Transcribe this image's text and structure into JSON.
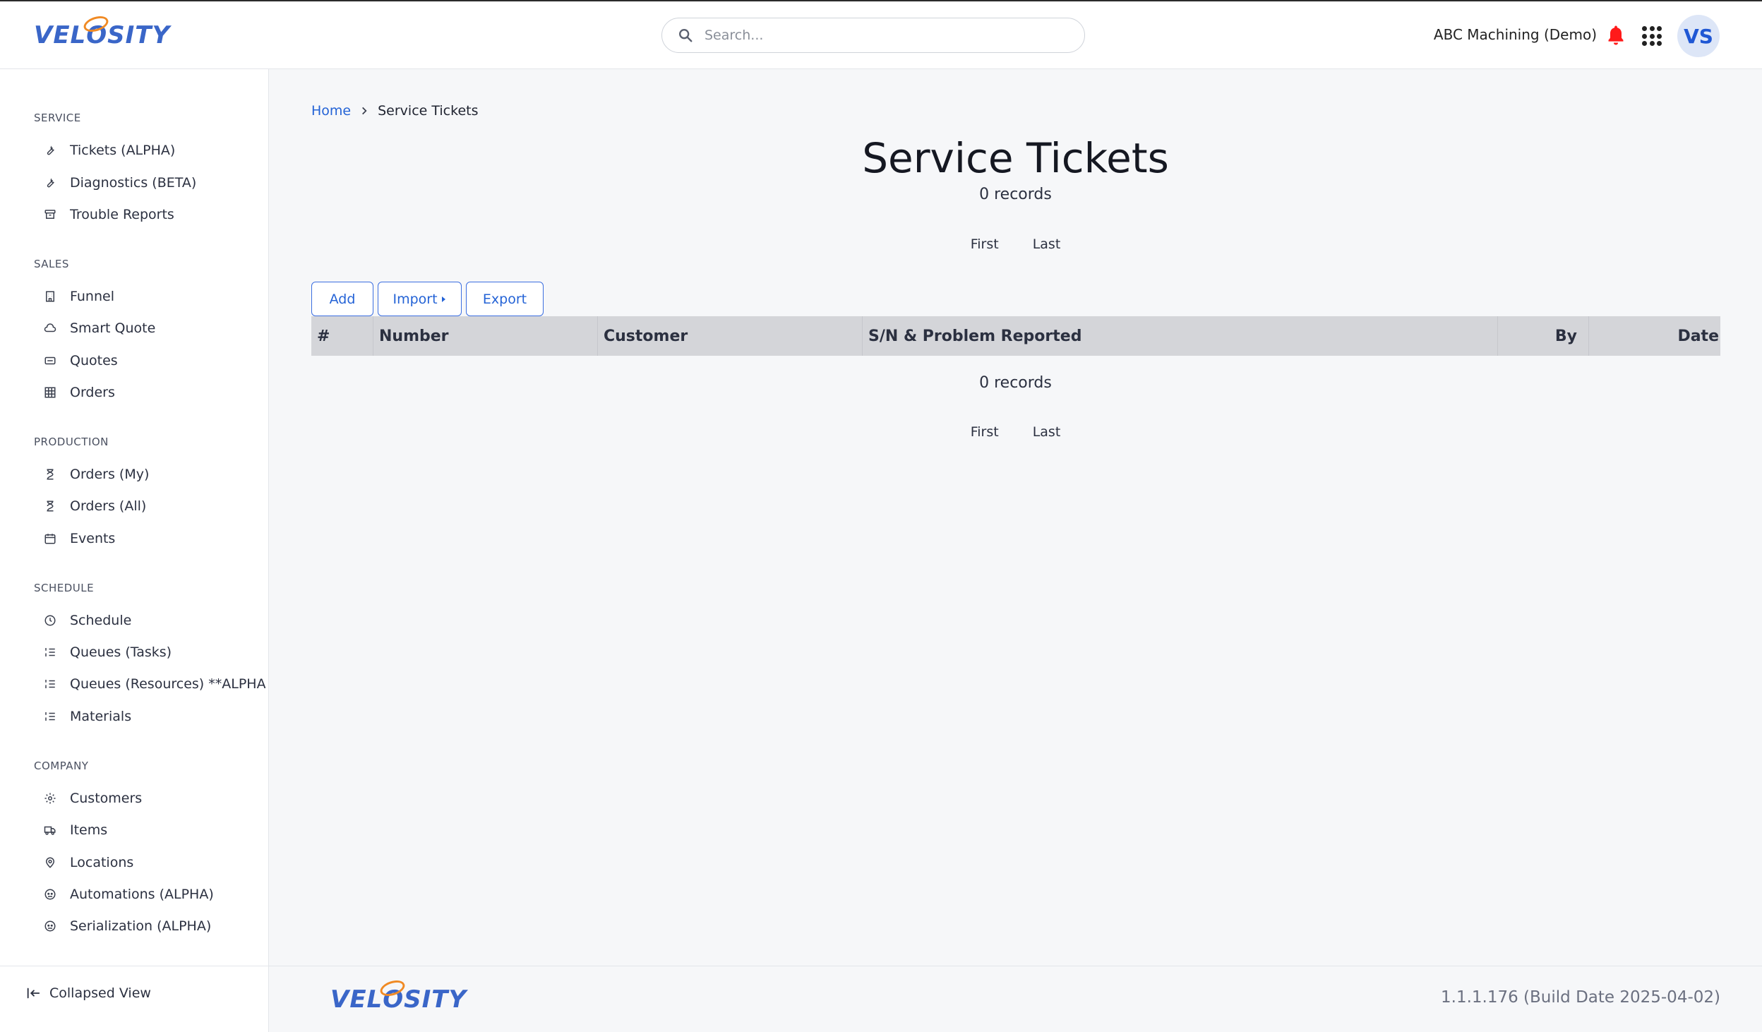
{
  "header": {
    "logo_text": "VELOSITY",
    "search_placeholder": "Search...",
    "company": "ABC Machining (Demo)",
    "avatar_initials": "VS",
    "bell_color": "#ff1a1a"
  },
  "sidebar": {
    "sections": [
      {
        "label": "SERVICE",
        "items": [
          {
            "label": "Tickets (ALPHA)",
            "icon": "wrench-icon"
          },
          {
            "label": "Diagnostics (BETA)",
            "icon": "wrench-icon"
          },
          {
            "label": "Trouble Reports",
            "icon": "archive-icon"
          }
        ]
      },
      {
        "label": "SALES",
        "items": [
          {
            "label": "Funnel",
            "icon": "building-icon"
          },
          {
            "label": "Smart Quote",
            "icon": "cloud-icon"
          },
          {
            "label": "Quotes",
            "icon": "ticket-icon"
          },
          {
            "label": "Orders",
            "icon": "grid-icon"
          }
        ]
      },
      {
        "label": "PRODUCTION",
        "items": [
          {
            "label": "Orders (My)",
            "icon": "hourglass-icon"
          },
          {
            "label": "Orders (All)",
            "icon": "hourglass-icon"
          },
          {
            "label": "Events",
            "icon": "calendar-icon"
          }
        ]
      },
      {
        "label": "SCHEDULE",
        "items": [
          {
            "label": "Schedule",
            "icon": "clock-icon"
          },
          {
            "label": "Queues (Tasks)",
            "icon": "list-ordered-icon"
          },
          {
            "label": "Queues (Resources) **ALPHA**",
            "icon": "list-ordered-icon"
          },
          {
            "label": "Materials",
            "icon": "list-ordered-icon"
          }
        ]
      },
      {
        "label": "COMPANY",
        "items": [
          {
            "label": "Customers",
            "icon": "cog-icon"
          },
          {
            "label": "Items",
            "icon": "truck-icon"
          },
          {
            "label": "Locations",
            "icon": "map-pin-icon"
          },
          {
            "label": "Automations (ALPHA)",
            "icon": "robot-icon"
          },
          {
            "label": "Serialization (ALPHA)",
            "icon": "robot-icon"
          }
        ]
      }
    ],
    "collapse_label": "Collapsed View"
  },
  "breadcrumb": {
    "home": "Home",
    "current": "Service Tickets"
  },
  "main": {
    "title": "Service Tickets",
    "records_top": "0 records",
    "records_bottom": "0 records",
    "pager": {
      "first": "First",
      "last": "Last"
    },
    "buttons": {
      "add": "Add",
      "import": "Import",
      "export": "Export"
    },
    "columns": [
      "#",
      "Number",
      "Customer",
      "S/N & Problem Reported",
      "By",
      "Date"
    ]
  },
  "footer": {
    "logo_text": "VELOSITY",
    "version": "1.1.1.176 (Build Date 2025-04-02)"
  },
  "colors": {
    "accent": "#2463d6",
    "header_row": "#d4d5d9",
    "logo_ring": "#f08a24"
  }
}
